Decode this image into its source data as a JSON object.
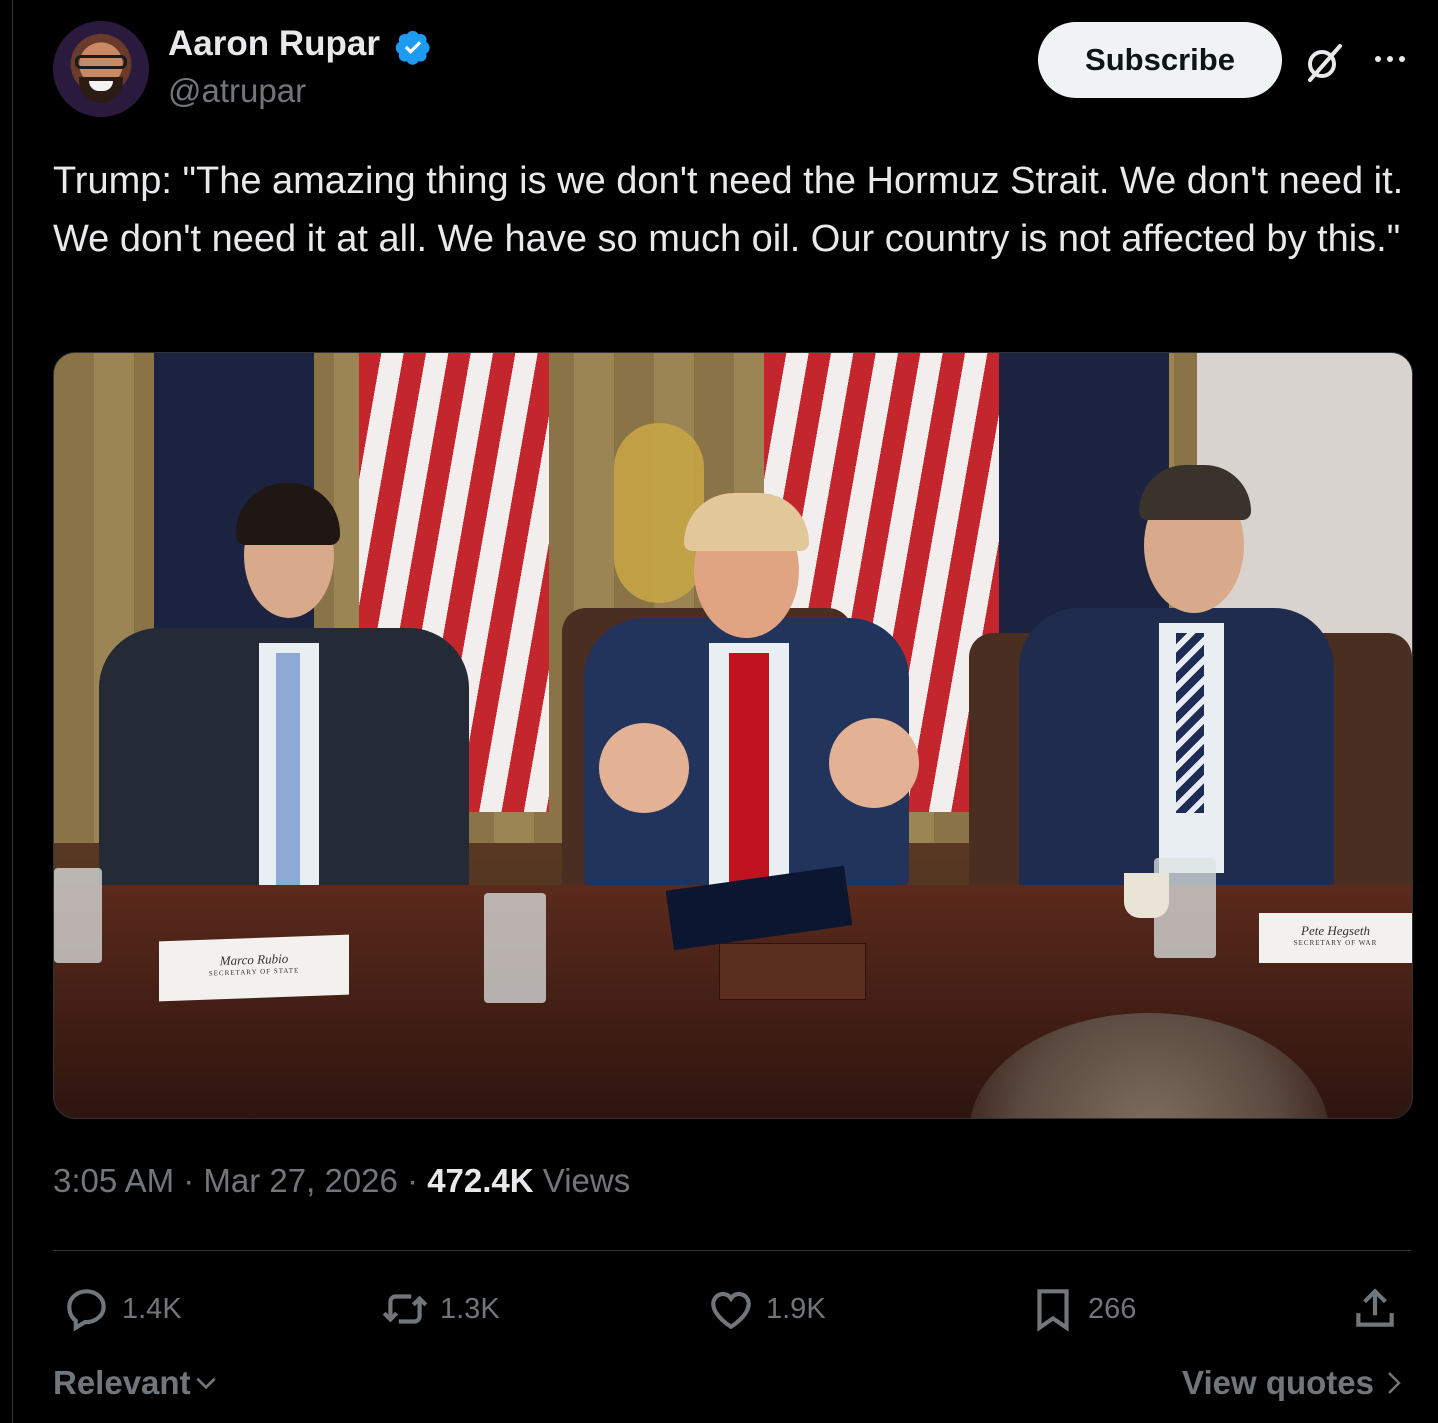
{
  "author": {
    "name": "Aaron Rupar",
    "handle": "@atrupar",
    "verified": true,
    "verified_color": "#1d9bf0"
  },
  "header": {
    "subscribe_label": "Subscribe",
    "grok_icon": "grok-icon",
    "more_icon": "more-icon"
  },
  "tweet": {
    "text": "Trump: \"The amazing thing is we don't need the Hormuz Strait. We don't need it. We don't need it at all. We have so much oil. Our country is not affected by this.\""
  },
  "media": {
    "type": "video-frame",
    "nameplate_left": "Marco Rubio",
    "nameplate_left_sub": "SECRETARY OF STATE",
    "nameplate_right": "Pete Hegseth",
    "nameplate_right_sub": "SECRETARY OF WAR"
  },
  "meta": {
    "time": "3:05 AM",
    "separator": " · ",
    "date": "Mar 27, 2026",
    "views_count": "472.4K",
    "views_label": " Views"
  },
  "actions": {
    "replies": "1.4K",
    "reposts": "1.3K",
    "likes": "1.9K",
    "bookmarks": "266"
  },
  "footer": {
    "sort_label": "Relevant",
    "view_quotes_label": "View quotes"
  }
}
